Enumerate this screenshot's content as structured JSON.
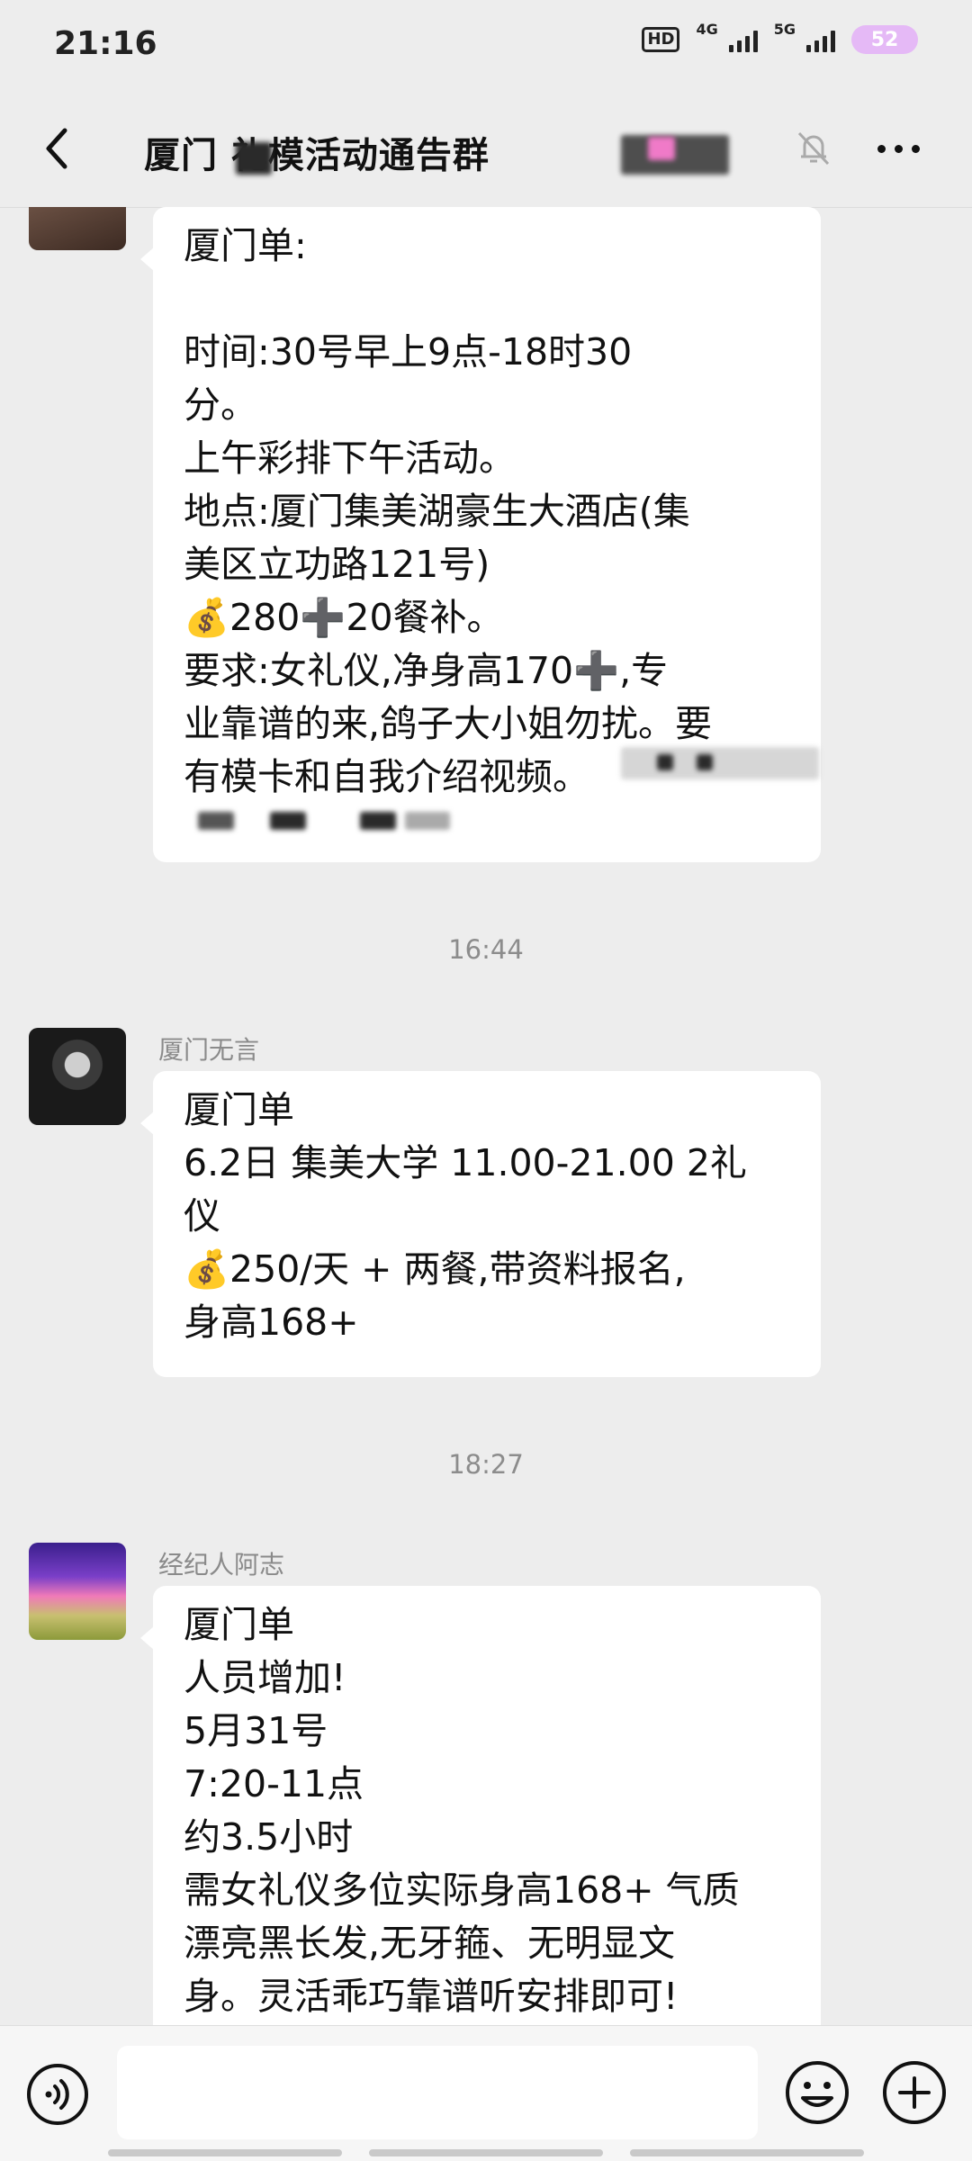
{
  "status": {
    "time": "21:16",
    "hd_label": "HD",
    "net1": "4G",
    "net2": "5G",
    "battery": "52"
  },
  "header": {
    "title": "厦门  礼模活动通告群"
  },
  "messages": [
    {
      "sender": "",
      "lines": [
        "厦门单:",
        "",
        "时间:30号早上9点-18时30",
        "分。",
        "上午彩排下午活动。",
        "地点:厦门集美湖豪生大酒店(集",
        "美区立功路121号)",
        "💰280➕20餐补。",
        "要求:女礼仪,净身高170➕,专",
        "业靠谱的来,鸽子大小姐勿扰。要",
        "有模卡和自我介绍视频。"
      ]
    },
    {
      "sender": "厦门无言",
      "lines": [
        "厦门单",
        "6.2日 集美大学 11.00-21.00 2礼",
        "仪",
        "💰250/天 + 两餐,带资料报名,",
        "身高168+"
      ]
    },
    {
      "sender": "经纪人阿志",
      "lines": [
        "厦门单",
        "人员增加!",
        "5月31号",
        "7:20-11点",
        "约3.5小时",
        "需女礼仪多位实际身高168+ 气质",
        "漂亮黑长发,无牙箍、无明显文",
        "身。灵活乖巧靠谱听安排即可!"
      ]
    }
  ],
  "timestamps": [
    "16:44",
    "18:27"
  ],
  "icons": [
    "back-icon",
    "mute-bell-icon",
    "more-icon",
    "voice-icon",
    "emoji-icon",
    "plus-icon"
  ]
}
